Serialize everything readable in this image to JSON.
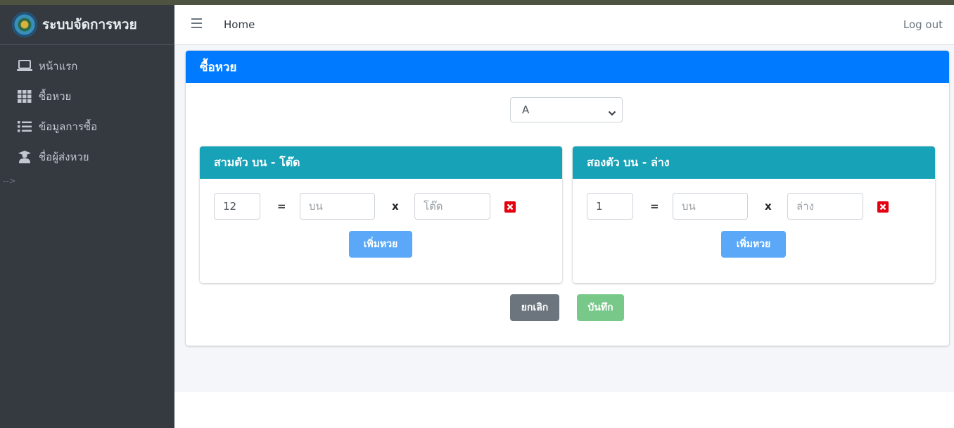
{
  "brand": {
    "title": "ระบบจัดการหวย"
  },
  "sidebar": {
    "items": [
      {
        "label": "หน้าแรก",
        "icon": "laptop-icon"
      },
      {
        "label": "ซื้อหวย",
        "icon": "grid-icon"
      },
      {
        "label": "ข้อมูลการซื้อ",
        "icon": "list-icon"
      },
      {
        "label": "ชื่อผู้ส่งหวย",
        "icon": "user-graduate-icon"
      }
    ],
    "stray_text": "-->"
  },
  "navbar": {
    "home_label": "Home",
    "logout_label": "Log out"
  },
  "main": {
    "title": "ซื้อหวย",
    "select_value": "A",
    "three_digit": {
      "title": "สามตัว บน - โต๊ด",
      "number_value": "12",
      "equals": "=",
      "times": "x",
      "top_placeholder": "บน",
      "tod_placeholder": "โต๊ด",
      "add_label": "เพิ่มหวย"
    },
    "two_digit": {
      "title": "สองตัว บน - ล่าง",
      "number_value": "1",
      "equals": "=",
      "times": "x",
      "top_placeholder": "บน",
      "bottom_placeholder": "ล่าง",
      "add_label": "เพิ่มหวย"
    },
    "cancel_label": "ยกเลิก",
    "save_label": "บันทึก"
  },
  "colors": {
    "sidebar_bg": "#343a40",
    "primary": "#007bff",
    "info": "#17a2b8",
    "add_button": "#5aa8f7",
    "cancel_button": "#6c757d",
    "save_button": "#78c889",
    "delete_icon": "#e3000f"
  }
}
